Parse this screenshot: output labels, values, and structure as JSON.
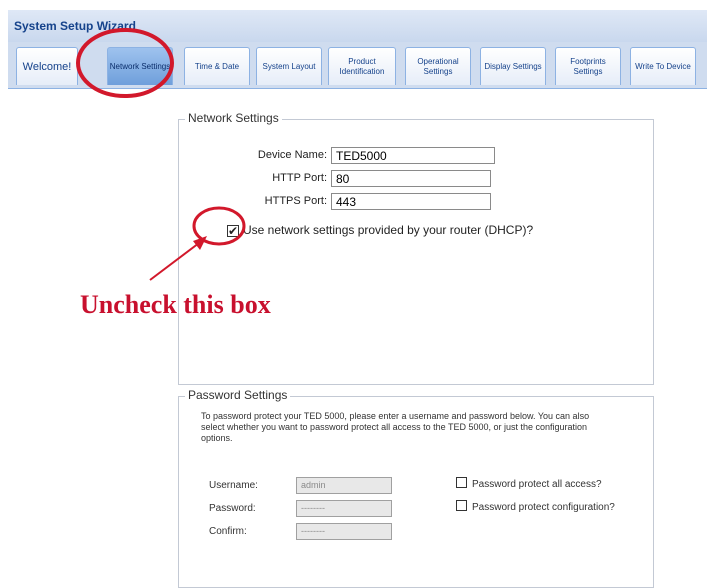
{
  "window": {
    "title": "System Setup Wizard"
  },
  "tabs": [
    {
      "label": "Welcome!"
    },
    {
      "label": "Network Settings"
    },
    {
      "label": "Time & Date"
    },
    {
      "label": "System Layout"
    },
    {
      "label": "Product Identification"
    },
    {
      "label": "Operational Settings"
    },
    {
      "label": "Display Settings"
    },
    {
      "label": "Footprints Settings"
    },
    {
      "label": "Write To Device"
    }
  ],
  "network": {
    "legend": "Network Settings",
    "device_name_label": "Device Name:",
    "device_name_value": "TED5000",
    "http_port_label": "HTTP Port:",
    "http_port_value": "80",
    "https_port_label": "HTTPS Port:",
    "https_port_value": "443",
    "dhcp_label": "Use network settings provided by your router (DHCP)?",
    "dhcp_checked": true
  },
  "annotation": {
    "text": "Uncheck this box",
    "color": "#c8102e"
  },
  "password": {
    "legend": "Password Settings",
    "description": "To password protect your TED 5000, please enter a username and password below. You can also select whether you want to password protect all access to the TED 5000, or just the configuration options.",
    "username_label": "Username:",
    "username_value": "admin",
    "password_label": "Password:",
    "password_value": "--------",
    "confirm_label": "Confirm:",
    "confirm_value": "--------",
    "protect_all_label": "Password protect all access?",
    "protect_config_label": "Password protect configuration?"
  }
}
